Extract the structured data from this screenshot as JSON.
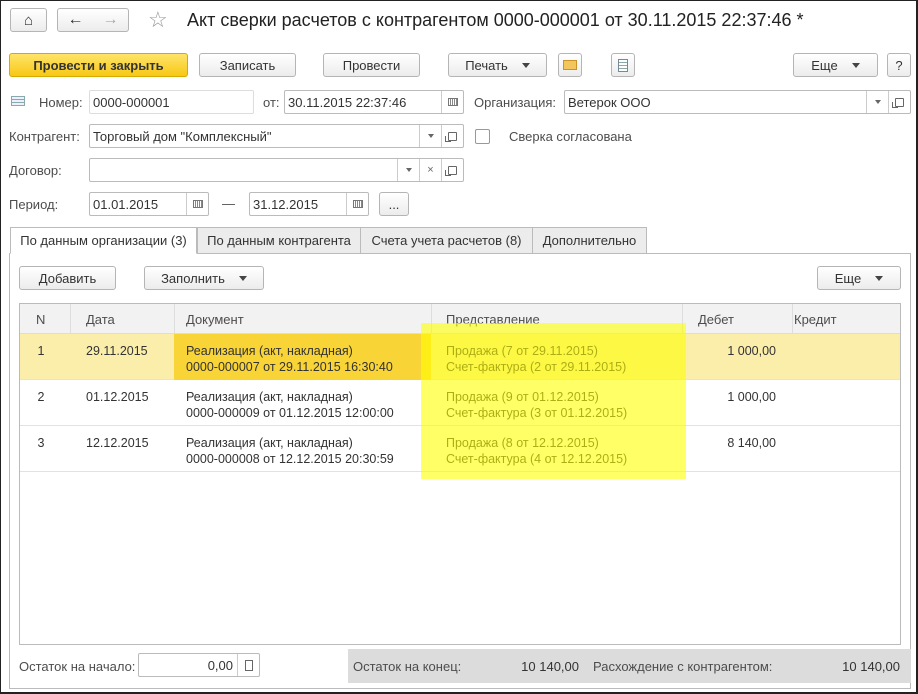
{
  "window": {
    "title": "Акт сверки расчетов с контрагентом 0000-000001 от 30.11.2015 22:37:46 *"
  },
  "toolbar": {
    "post_close": "Провести и закрыть",
    "save": "Записать",
    "post": "Провести",
    "print": "Печать",
    "more": "Еще",
    "help": "?"
  },
  "fields": {
    "number_label": "Номер:",
    "number": "0000-000001",
    "date_label": "от:",
    "date": "30.11.2015 22:37:46",
    "org_label": "Организация:",
    "org": "Ветерок ООО",
    "counterparty_label": "Контрагент:",
    "counterparty": "Торговый дом \"Комплексный\"",
    "agreed_label": "Сверка согласована",
    "contract_label": "Договор:",
    "contract": "",
    "period_label": "Период:",
    "period_from": "01.01.2015",
    "period_dash": "—",
    "period_to": "31.12.2015",
    "period_more": "..."
  },
  "tabs": [
    {
      "label": "По данным организации (3)",
      "active": true
    },
    {
      "label": "По данным контрагента"
    },
    {
      "label": "Счета учета расчетов (8)"
    },
    {
      "label": "Дополнительно"
    }
  ],
  "table_toolbar": {
    "add": "Добавить",
    "fill": "Заполнить",
    "more": "Еще"
  },
  "table": {
    "columns": [
      "N",
      "Дата",
      "Документ",
      "Представление",
      "Дебет",
      "Кредит"
    ],
    "rows": [
      {
        "n": "1",
        "date": "29.11.2015",
        "doc1": "Реализация (акт, накладная)",
        "doc2": "0000-000007 от 29.11.2015 16:30:40",
        "rep1": "Продажа (7 от 29.11.2015)",
        "rep2": "Счет-фактура (2 от 29.11.2015)",
        "debit": "1 000,00",
        "credit": ""
      },
      {
        "n": "2",
        "date": "01.12.2015",
        "doc1": "Реализация (акт, накладная)",
        "doc2": "0000-000009 от 01.12.2015 12:00:00",
        "rep1": "Продажа (9 от 01.12.2015)",
        "rep2": "Счет-фактура (3 от 01.12.2015)",
        "debit": "1 000,00",
        "credit": ""
      },
      {
        "n": "3",
        "date": "12.12.2015",
        "doc1": "Реализация (акт, накладная)",
        "doc2": "0000-000008 от 12.12.2015 20:30:59",
        "rep1": "Продажа (8 от 12.12.2015)",
        "rep2": "Счет-фактура (4 от 12.12.2015)",
        "debit": "8 140,00",
        "credit": ""
      }
    ]
  },
  "footer": {
    "start_label": "Остаток на начало:",
    "start_value": "0,00",
    "end_label": "Остаток на конец:",
    "end_value": "10 140,00",
    "diff_label": "Расхождение с контрагентом:",
    "diff_value": "10 140,00"
  }
}
